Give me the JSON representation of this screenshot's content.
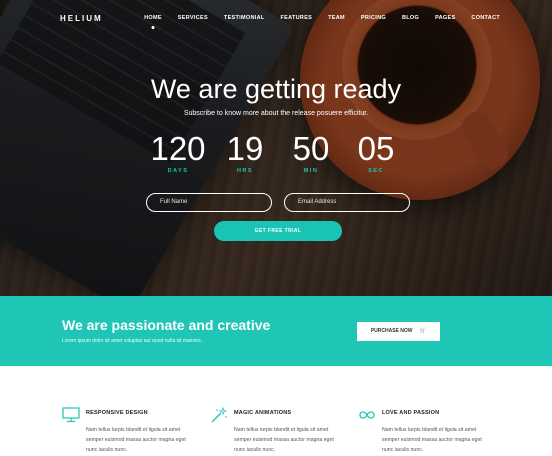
{
  "brand": "HELIUM",
  "nav": [
    "HOME",
    "SERVICES",
    "TESTIMONIAL",
    "FEATURES",
    "TEAM",
    "PRICING",
    "BLOG",
    "PAGES",
    "CONTACT"
  ],
  "nav_active": "HOME",
  "hero": {
    "headline": "We are getting ready",
    "subtitle": "Subscribe to know more about the release posuere efficitur.",
    "countdown": [
      {
        "value": "120",
        "label": "DAYS"
      },
      {
        "value": "19",
        "label": "HRS"
      },
      {
        "value": "50",
        "label": "MIN"
      },
      {
        "value": "05",
        "label": "SEC"
      }
    ],
    "name_placeholder": "Full Name",
    "email_placeholder": "Email Address",
    "cta": "GET FREE TRIAL"
  },
  "band": {
    "title": "We are passionate and creative",
    "text": "Lorem ipsum dolor sit amet voluptas aut quod nulla sit maiores.",
    "button": "PURCHASE NOW"
  },
  "features": [
    {
      "icon": "monitor-icon",
      "title": "RESPONSIVE DESIGN",
      "text": "Nam tellus turpis blandit et ligula sit amet semper euismod massa auctor magna eget nunc iaculis nunc."
    },
    {
      "icon": "magic-wand-icon",
      "title": "MAGIC ANIMATIONS",
      "text": "Nam tellus turpis blandit et ligula sit amet semper euismod massa auctor magna eget nunc iaculis nunc."
    },
    {
      "icon": "infinity-icon",
      "title": "LOVE AND PASSION",
      "text": "Nam tellus turpis blandit et ligula sit amet semper euismod massa auctor magna eget nunc iaculis nunc."
    }
  ],
  "colors": {
    "accent": "#19c4b4",
    "band": "#1fc6b6"
  }
}
